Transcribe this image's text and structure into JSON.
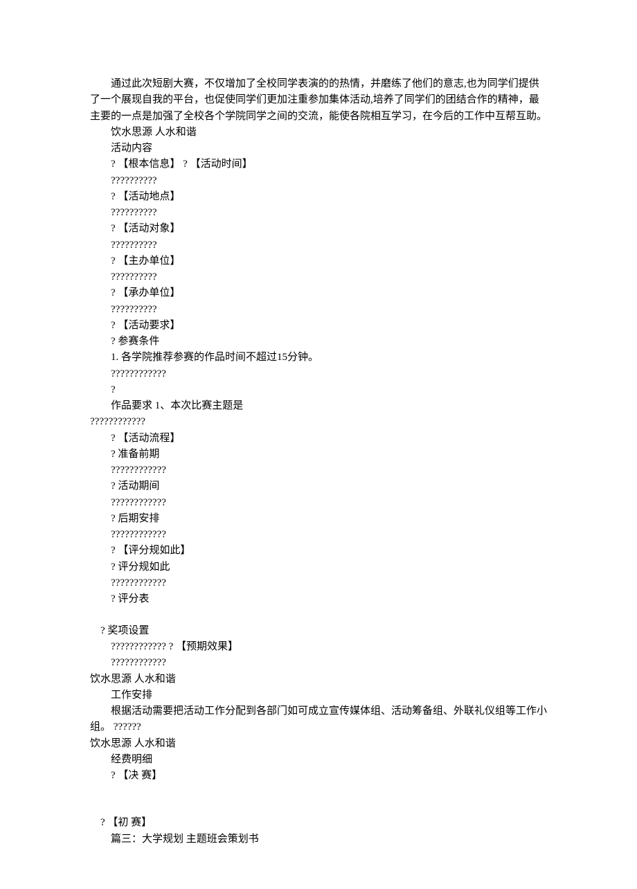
{
  "intro": "通过此次短剧大赛，不仅增加了全校同学表演的的热情，并磨练了他们的意志,也为同学们提供了一个展现自我的平台，也促使同学们更加注重参加集体活动,培养了同学们的团结合作的精神，最主要的一点是加强了全校各个学院同学之间的交流，能使各院相互学习，在今后的工作中互帮互助。",
  "slogan": "饮水思源  人水和谐",
  "section_activity_content": "活动内容",
  "line_basic_info": "? 【根本信息】  ? 【活动时间】",
  "placeholder10": "??????????",
  "line_location": "? 【活动地点】",
  "line_target": "? 【活动对象】",
  "line_host": "? 【主办单位】",
  "line_organizer": "? 【承办单位】",
  "line_requirements": "? 【活动要求】",
  "line_entry_conditions": "?  参赛条件",
  "line_rule1": "1.   各学院推荐参赛的作品时间不超过15分钟。",
  "placeholder12": "????????????",
  "single_q": "?",
  "line_work_req": "作品要求  1、本次比赛主题是",
  "line_process": "? 【活动流程】",
  "line_prep": "?  准备前期",
  "line_during": "?  活动期间",
  "line_post": "?  后期安排",
  "line_scoring_rules": "? 【评分规如此】",
  "line_scoring_rules2": "?  评分规如此",
  "line_score_table": "?  评分表",
  "line_awards": "?  奖项设置",
  "line_expected": "????????????  ? 【预期效果】",
  "section_work_arrange": "工作安排",
  "work_arrange_text": "根据活动需要把活动工作分配到各部门如可成立宣传媒体组、活动筹备组、外联礼仪组等工作小组。   ??????",
  "section_budget": "经费明细",
  "line_final": "? 【决        赛】",
  "line_prelim": "? 【初        赛】",
  "line_part3": "篇三：大学规划  主题班会策划书"
}
